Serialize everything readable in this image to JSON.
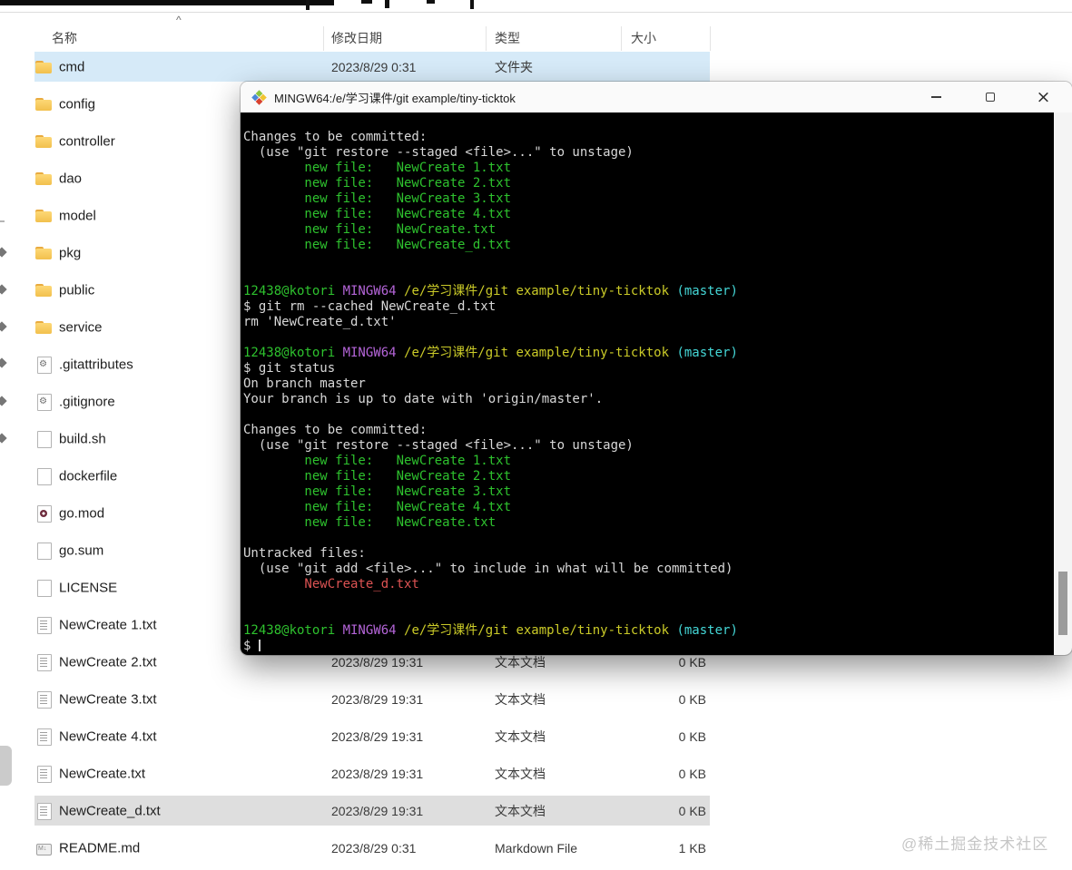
{
  "explorer": {
    "columns": {
      "name": "名称",
      "date": "修改日期",
      "type": "类型",
      "size": "大小"
    },
    "sort_indicator": "^",
    "rows": [
      {
        "name": "cmd",
        "icon": "folder",
        "date": "2023/8/29 0:31",
        "type": "文件夹",
        "size": "",
        "highlight": "blue"
      },
      {
        "name": "config",
        "icon": "folder",
        "date": "",
        "type": "",
        "size": "",
        "highlight": ""
      },
      {
        "name": "controller",
        "icon": "folder",
        "date": "",
        "type": "",
        "size": "",
        "highlight": ""
      },
      {
        "name": "dao",
        "icon": "folder",
        "date": "",
        "type": "",
        "size": "",
        "highlight": ""
      },
      {
        "name": "model",
        "icon": "folder",
        "date": "",
        "type": "",
        "size": "",
        "highlight": ""
      },
      {
        "name": "pkg",
        "icon": "folder",
        "date": "",
        "type": "",
        "size": "",
        "highlight": ""
      },
      {
        "name": "public",
        "icon": "folder",
        "date": "",
        "type": "",
        "size": "",
        "highlight": ""
      },
      {
        "name": "service",
        "icon": "folder",
        "date": "",
        "type": "",
        "size": "",
        "highlight": ""
      },
      {
        "name": ".gitattributes",
        "icon": "git-config",
        "date": "",
        "type": "",
        "size": "",
        "highlight": ""
      },
      {
        "name": ".gitignore",
        "icon": "git-config",
        "date": "",
        "type": "",
        "size": "",
        "highlight": ""
      },
      {
        "name": "build.sh",
        "icon": "file",
        "date": "",
        "type": "",
        "size": "",
        "highlight": ""
      },
      {
        "name": "dockerfile",
        "icon": "file",
        "date": "",
        "type": "",
        "size": "",
        "highlight": ""
      },
      {
        "name": "go.mod",
        "icon": "go-mod",
        "date": "",
        "type": "",
        "size": "",
        "highlight": ""
      },
      {
        "name": "go.sum",
        "icon": "file",
        "date": "",
        "type": "",
        "size": "",
        "highlight": ""
      },
      {
        "name": "LICENSE",
        "icon": "file",
        "date": "",
        "type": "",
        "size": "",
        "highlight": ""
      },
      {
        "name": "NewCreate 1.txt",
        "icon": "text",
        "date": "",
        "type": "",
        "size": "",
        "highlight": ""
      },
      {
        "name": "NewCreate 2.txt",
        "icon": "text",
        "date": "2023/8/29 19:31",
        "type": "文本文档",
        "size": "0 KB",
        "highlight": ""
      },
      {
        "name": "NewCreate 3.txt",
        "icon": "text",
        "date": "2023/8/29 19:31",
        "type": "文本文档",
        "size": "0 KB",
        "highlight": ""
      },
      {
        "name": "NewCreate 4.txt",
        "icon": "text",
        "date": "2023/8/29 19:31",
        "type": "文本文档",
        "size": "0 KB",
        "highlight": ""
      },
      {
        "name": "NewCreate.txt",
        "icon": "text",
        "date": "2023/8/29 19:31",
        "type": "文本文档",
        "size": "0 KB",
        "highlight": ""
      },
      {
        "name": "NewCreate_d.txt",
        "icon": "text",
        "date": "2023/8/29 19:31",
        "type": "文本文档",
        "size": "0 KB",
        "highlight": "gray"
      },
      {
        "name": "README.md",
        "icon": "markdown",
        "date": "2023/8/29 0:31",
        "type": "Markdown File",
        "size": "1 KB",
        "highlight": ""
      }
    ]
  },
  "terminal": {
    "title": "MINGW64:/e/学习课件/git example/tiny-ticktok",
    "icons": {
      "app": "mintty-diamonds",
      "minimize": "minus-line",
      "maximize": "square-outline",
      "close": "×"
    },
    "palette": {
      "fg": "#d8d8d8",
      "green": "#2ec22e",
      "purple": "#b565d9",
      "yellow": "#cbcb28",
      "cyan": "#44d7d7",
      "red": "#dd5353",
      "cursor": "#cfcfcf"
    },
    "lines": [
      [
        [
          "fg",
          "Changes to be committed:"
        ]
      ],
      [
        [
          "fg",
          "  (use \"git restore --staged <file>...\" to unstage)"
        ]
      ],
      [
        [
          "green",
          "        new file:   NewCreate 1.txt"
        ]
      ],
      [
        [
          "green",
          "        new file:   NewCreate 2.txt"
        ]
      ],
      [
        [
          "green",
          "        new file:   NewCreate 3.txt"
        ]
      ],
      [
        [
          "green",
          "        new file:   NewCreate 4.txt"
        ]
      ],
      [
        [
          "green",
          "        new file:   NewCreate.txt"
        ]
      ],
      [
        [
          "green",
          "        new file:   NewCreate_d.txt"
        ]
      ],
      [],
      [],
      [
        [
          "green",
          "12438@kotori "
        ],
        [
          "purple",
          "MINGW64 "
        ],
        [
          "yellow",
          "/e/学习课件/git example/tiny-ticktok "
        ],
        [
          "cyan",
          "(master)"
        ]
      ],
      [
        [
          "fg",
          "$ git rm --cached NewCreate_d.txt"
        ]
      ],
      [
        [
          "fg",
          "rm 'NewCreate_d.txt'"
        ]
      ],
      [],
      [
        [
          "green",
          "12438@kotori "
        ],
        [
          "purple",
          "MINGW64 "
        ],
        [
          "yellow",
          "/e/学习课件/git example/tiny-ticktok "
        ],
        [
          "cyan",
          "(master)"
        ]
      ],
      [
        [
          "fg",
          "$ git status"
        ]
      ],
      [
        [
          "fg",
          "On branch master"
        ]
      ],
      [
        [
          "fg",
          "Your branch is up to date with 'origin/master'."
        ]
      ],
      [],
      [
        [
          "fg",
          "Changes to be committed:"
        ]
      ],
      [
        [
          "fg",
          "  (use \"git restore --staged <file>...\" to unstage)"
        ]
      ],
      [
        [
          "green",
          "        new file:   NewCreate 1.txt"
        ]
      ],
      [
        [
          "green",
          "        new file:   NewCreate 2.txt"
        ]
      ],
      [
        [
          "green",
          "        new file:   NewCreate 3.txt"
        ]
      ],
      [
        [
          "green",
          "        new file:   NewCreate 4.txt"
        ]
      ],
      [
        [
          "green",
          "        new file:   NewCreate.txt"
        ]
      ],
      [],
      [
        [
          "fg",
          "Untracked files:"
        ]
      ],
      [
        [
          "fg",
          "  (use \"git add <file>...\" to include in what will be committed)"
        ]
      ],
      [
        [
          "red",
          "        NewCreate_d.txt"
        ]
      ],
      [],
      [],
      [
        [
          "green",
          "12438@kotori "
        ],
        [
          "purple",
          "MINGW64 "
        ],
        [
          "yellow",
          "/e/学习课件/git example/tiny-ticktok "
        ],
        [
          "cyan",
          "(master)"
        ]
      ],
      [
        [
          "fg",
          "$ "
        ],
        [
          "cursor",
          ""
        ]
      ]
    ]
  },
  "watermark": "@稀土掘金技术社区"
}
